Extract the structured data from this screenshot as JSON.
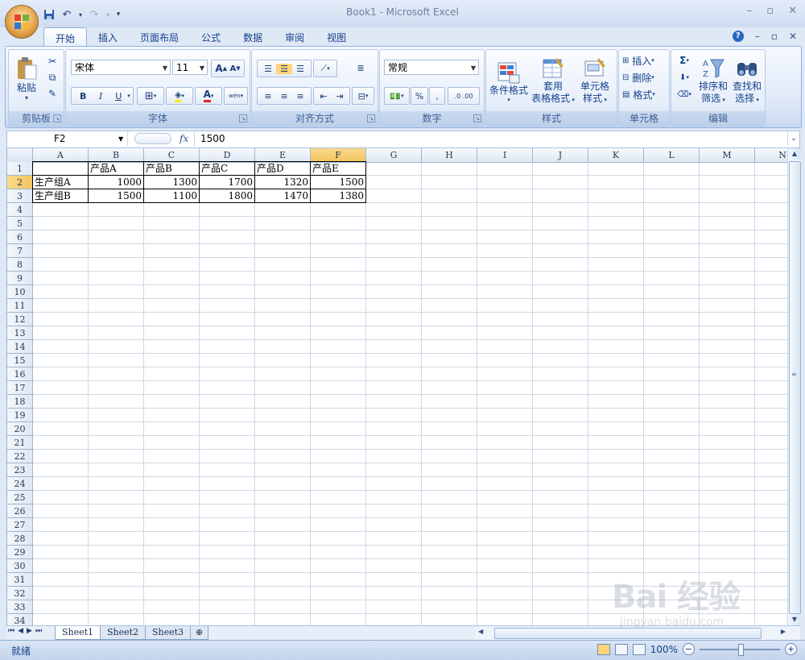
{
  "window": {
    "title": "Book1 - Microsoft Excel",
    "minimize": "–",
    "restore": "▫",
    "close": "✕"
  },
  "qat": {
    "dropdown": "▾"
  },
  "tabs": [
    "开始",
    "插入",
    "页面布局",
    "公式",
    "数据",
    "审阅",
    "视图"
  ],
  "ribbon": {
    "clipboard": {
      "label": "剪贴板",
      "paste": "粘贴"
    },
    "font": {
      "label": "字体",
      "name": "宋体",
      "size": "11",
      "grow": "A",
      "shrink": "A",
      "bold": "B",
      "italic": "I",
      "underline": "U",
      "font_color": "A",
      "phonetic": "wén"
    },
    "alignment": {
      "label": "对齐方式"
    },
    "number": {
      "label": "数字",
      "format": "常规",
      "percent": "%",
      "comma": ",",
      "inc_decimal": ".0",
      "dec_decimal": ".00"
    },
    "styles": {
      "label": "样式",
      "cond_format": "条件格式",
      "table_format_1": "套用",
      "table_format_2": "表格格式",
      "cell_styles_1": "单元格",
      "cell_styles_2": "样式"
    },
    "cells": {
      "label": "单元格",
      "insert": "插入",
      "delete": "删除",
      "format": "格式"
    },
    "editing": {
      "label": "编辑",
      "sum": "Σ",
      "sort_1": "排序和",
      "sort_2": "筛选",
      "find_1": "查找和",
      "find_2": "选择"
    }
  },
  "formula_bar": {
    "name_box": "F2",
    "fx": "fx",
    "value": "1500"
  },
  "grid": {
    "columns": [
      "A",
      "B",
      "C",
      "D",
      "E",
      "F",
      "G",
      "H",
      "I",
      "J",
      "K",
      "L",
      "M",
      "N"
    ],
    "rows": [
      "1",
      "2",
      "3",
      "4",
      "5",
      "6",
      "7",
      "8",
      "9",
      "10",
      "11",
      "12",
      "13",
      "14",
      "15",
      "16",
      "17",
      "18",
      "19",
      "20",
      "21",
      "22",
      "23",
      "24",
      "25",
      "26",
      "27",
      "28",
      "29",
      "30",
      "31",
      "32",
      "33",
      "34"
    ],
    "header_row": [
      "",
      "产品A",
      "产品B",
      "产品C",
      "产品D",
      "产品E"
    ],
    "data_rows": [
      [
        "生产组A",
        "1000",
        "1300",
        "1700",
        "1320",
        "1500"
      ],
      [
        "生产组B",
        "1500",
        "1100",
        "1800",
        "1470",
        "1380"
      ]
    ]
  },
  "sheets": [
    "Sheet1",
    "Sheet2",
    "Sheet3"
  ],
  "status": {
    "text": "就绪",
    "zoom": "100%",
    "zoom_level": 1.0
  },
  "watermark": {
    "brand": "Bai 经验",
    "url": "jingyan.baidu.com"
  }
}
